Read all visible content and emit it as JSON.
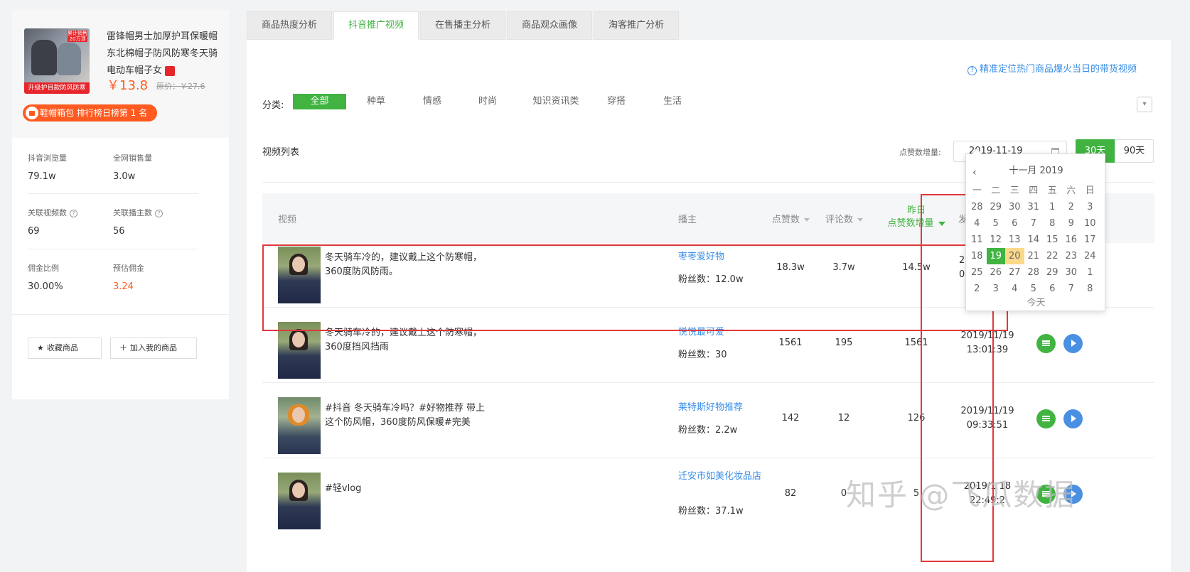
{
  "product": {
    "title": "雷锋帽男士加厚护耳保暖帽东北棉帽子防风防寒冬天骑电动车帽子女",
    "thumb_badge": "累计销售20万顶",
    "thumb_band": "升级护目款防风防寒",
    "price": "￥13.8",
    "old_price": "原价：￥27.6",
    "rank": "鞋帽箱包 排行榜日榜第 1 名"
  },
  "stats": {
    "douyin_views_label": "抖音浏览量",
    "douyin_views": "79.1w",
    "net_sales_label": "全网销售量",
    "net_sales": "3.0w",
    "related_videos_label": "关联视频数",
    "related_videos": "69",
    "related_anchors_label": "关联播主数",
    "related_anchors": "56",
    "commission_rate_label": "佣金比例",
    "commission_rate": "30.00%",
    "est_commission_label": "预估佣金",
    "est_commission": "3.24"
  },
  "actions": {
    "favorite": "收藏商品",
    "add_mine": "加入我的商品"
  },
  "tabs": [
    "商品热度分析",
    "抖音推广视频",
    "在售播主分析",
    "商品观众画像",
    "淘客推广分析"
  ],
  "help_link": "精准定位热门商品爆火当日的带货视频",
  "categories": {
    "label": "分类:",
    "items": [
      "全部",
      "种草",
      "情感",
      "时尚",
      "知识资讯类",
      "穿搭",
      "生活"
    ]
  },
  "list": {
    "title": "视频列表",
    "date_label": "点赞数增量:",
    "date_value": "2019-11-19",
    "range_30": "30天",
    "range_90": "90天"
  },
  "columns": {
    "video": "视频",
    "anchor": "播主",
    "likes": "点赞数",
    "comments": "评论数",
    "yesterday_line1": "昨日",
    "yesterday_line2": "点赞数增量",
    "publish": "发布时"
  },
  "rows": [
    {
      "title": "冬天骑车冷的，建议戴上这个防寒帽，360度防风防雨。",
      "anchor": "枣枣爱好物",
      "fans": "粉丝数：12.0w",
      "likes": "18.3w",
      "comments": "3.7w",
      "increase": "14.5w",
      "date": "2019/",
      "time": "09:"
    },
    {
      "title": "冬天骑车冷的，建议戴上这个防寒帽，360度挡风挡雨",
      "anchor": "悦悦最可爱",
      "fans": "粉丝数：30",
      "likes": "1561",
      "comments": "195",
      "increase": "1561",
      "date": "2019/11/19",
      "time": "13:01:39"
    },
    {
      "title": "#抖音 冬天骑车冷吗？#好物推荐 带上这个防风帽，360度防风保暖#完美",
      "anchor": "莱特斯好物推荐",
      "fans": "粉丝数：2.2w",
      "likes": "142",
      "comments": "12",
      "increase": "126",
      "date": "2019/11/19",
      "time": "09:33:51"
    },
    {
      "title": "#轻vlog",
      "anchor": "迁安市如美化妆品店",
      "fans": "粉丝数：37.1w",
      "likes": "82",
      "comments": "0",
      "increase": "5",
      "date": "2019/1 18",
      "time": "22:49:2"
    }
  ],
  "calendar": {
    "title": "十一月 2019",
    "weekdays": [
      "一",
      "二",
      "三",
      "四",
      "五",
      "六",
      "日"
    ],
    "weeks": [
      [
        "28",
        "29",
        "30",
        "31",
        "1",
        "2",
        "3"
      ],
      [
        "4",
        "5",
        "6",
        "7",
        "8",
        "9",
        "10"
      ],
      [
        "11",
        "12",
        "13",
        "14",
        "15",
        "16",
        "17"
      ],
      [
        "18",
        "19",
        "20",
        "21",
        "22",
        "23",
        "24"
      ],
      [
        "25",
        "26",
        "27",
        "28",
        "29",
        "30",
        "1"
      ],
      [
        "2",
        "3",
        "4",
        "5",
        "6",
        "7",
        "8"
      ]
    ],
    "selected": "19",
    "highlighted": "20",
    "today_label": "今天"
  },
  "watermark": "知乎 @飞瓜数据",
  "colors": {
    "accent": "#41b341",
    "link": "#3a8ee6",
    "price": "#ff5a1f",
    "highlight": "#e0393e"
  }
}
